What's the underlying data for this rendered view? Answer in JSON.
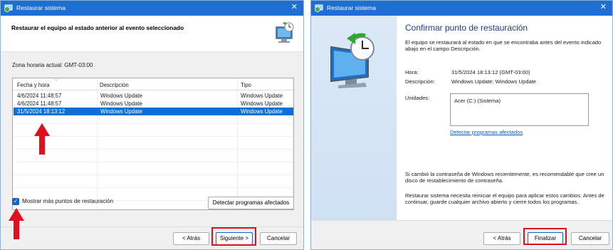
{
  "left_window": {
    "title": "Restaurar sistema",
    "close_glyph": "✕",
    "heading": "Restaurar el equipo al estado anterior al evento seleccionado",
    "timezone": "Zona horaria actual: GMT-03:00",
    "columns": [
      "Fecha y hora",
      "Descripción",
      "Tipo"
    ],
    "rows": [
      {
        "date": "4/6/2024 11:48:57",
        "description": "Windows Update",
        "type": "Windows Update",
        "selected": false
      },
      {
        "date": "4/6/2024 11:48:57",
        "description": "Windows Update",
        "type": "Windows Update",
        "selected": false
      },
      {
        "date": "31/5/2024 18:13:12",
        "description": "Windows Update",
        "type": "Windows Update",
        "selected": true
      }
    ],
    "show_more_label": "Mostrar más puntos de restauración",
    "show_more_checked": true,
    "detect_button": "Detectar programas afectados",
    "back_button": "< Atrás",
    "next_button": "Siguiente >",
    "cancel_button": "Cancelar"
  },
  "right_window": {
    "title": "Restaurar sistema",
    "close_glyph": "✕",
    "heading": "Confirmar punto de restauración",
    "intro": "El equipo se restaurará al estado en que se encontraba antes del evento indicado abajo en el campo Descripción.",
    "time_label": "Hora:",
    "time_value": "31/5/2024 18:13:12 (GMT-03:00)",
    "description_label": "Descripción:",
    "description_value": "Windows Update: Windows Update",
    "drives_label": "Unidades:",
    "drives_value": "Acer (C:) (Sistema)",
    "detect_link": "Detectar programas afectados",
    "password_note": "Si cambió la contraseña de Windows recientemente, es recomendable que cree un disco de restablecimiento de contraseña.",
    "restart_note": "Restaurar sistema necesita reiniciar el equipo para aplicar estos cambios. Antes de continuar, guarde cualquier archivo abierto y cierre todos los programas.",
    "back_button": "< Atrás",
    "finish_button": "Finalizar",
    "cancel_button": "Cancelar"
  },
  "colors": {
    "titlebar": "#1f6ed4",
    "selection": "#0a6fd6",
    "highlight": "#e0101c",
    "heading_blue": "#1e3a8a",
    "link": "#0b5fc4"
  },
  "icons": [
    "restore-app-icon",
    "restore-monitor-clock-icon",
    "checkmark-icon",
    "close-icon",
    "red-arrow-up-icon"
  ]
}
